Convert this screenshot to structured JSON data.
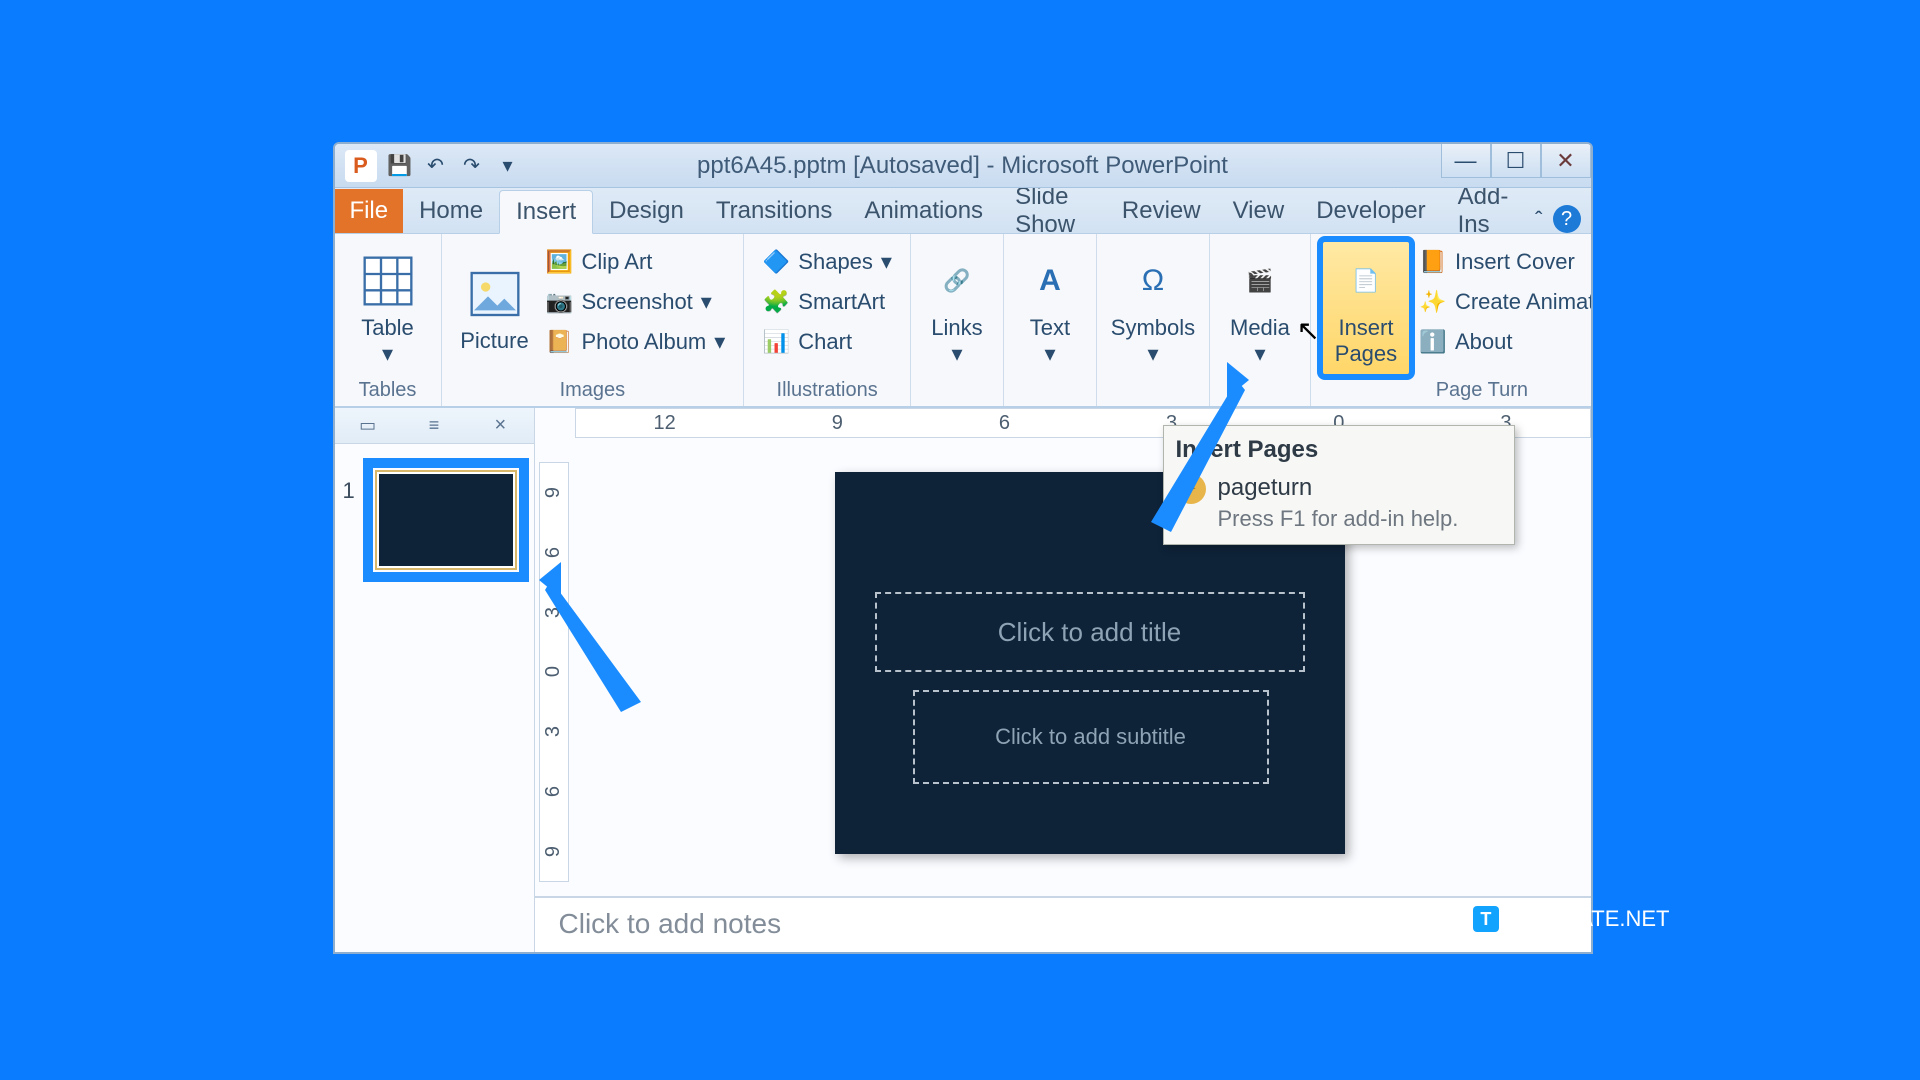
{
  "title": "ppt6A45.pptm [Autosaved] - Microsoft PowerPoint",
  "tabs": {
    "file": "File",
    "list": [
      "Home",
      "Insert",
      "Design",
      "Transitions",
      "Animations",
      "Slide Show",
      "Review",
      "View",
      "Developer",
      "Add-Ins"
    ],
    "active": "Insert"
  },
  "ribbon": {
    "tables": {
      "label": "Tables",
      "table": "Table"
    },
    "images": {
      "label": "Images",
      "picture": "Picture",
      "clipart": "Clip Art",
      "screenshot": "Screenshot",
      "photoalbum": "Photo Album"
    },
    "illustrations": {
      "label": "Illustrations",
      "shapes": "Shapes",
      "smartart": "SmartArt",
      "chart": "Chart"
    },
    "links": {
      "label": "Links",
      "btn": "Links"
    },
    "text": {
      "label": "Text",
      "btn": "Text"
    },
    "symbols": {
      "label": "Symbols",
      "btn": "Symbols"
    },
    "media": {
      "label": "Media",
      "btn": "Media"
    },
    "pageturn": {
      "label": "Page Turn",
      "insertpages": "Insert Pages",
      "insertcover": "Insert Cover",
      "createanim": "Create Animations",
      "about": "About"
    }
  },
  "ruler": {
    "h": [
      "12",
      "9",
      "6",
      "3",
      "0",
      "3"
    ],
    "v": [
      "9",
      "6",
      "3",
      "0",
      "3",
      "6",
      "9"
    ]
  },
  "slide": {
    "number": "1",
    "title_ph": "Click to add title",
    "subtitle_ph": "Click to add subtitle"
  },
  "notes": "Click to add notes",
  "tooltip": {
    "title": "Insert Pages",
    "name": "pageturn",
    "help": "Press F1 for add-in help."
  },
  "watermark": "TEMPLATE.NET"
}
